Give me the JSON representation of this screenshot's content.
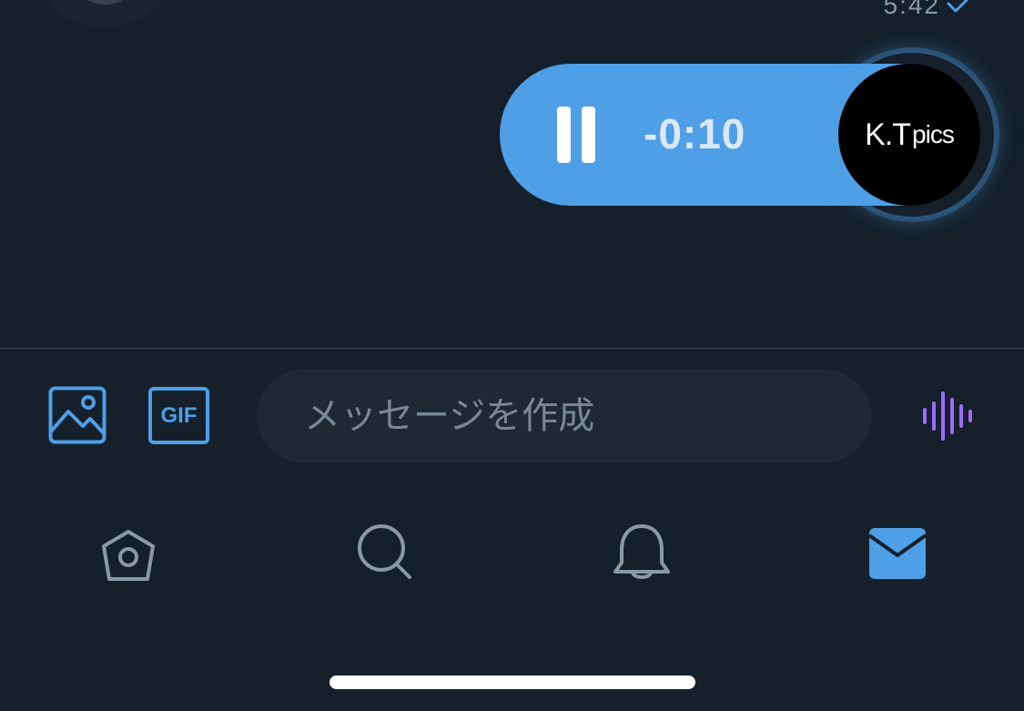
{
  "message": {
    "timestamp": "5:42",
    "voice": {
      "remaining": "-0:10",
      "state": "playing",
      "speaker_label_main": "K.T",
      "speaker_label_sub": "pics"
    }
  },
  "composer": {
    "placeholder": "メッセージを作成",
    "image_icon": "image-icon",
    "gif_label": "GIF",
    "voice_icon": "waveform-icon"
  },
  "tabbar": {
    "items": [
      {
        "name": "home",
        "icon": "home-icon",
        "active": false
      },
      {
        "name": "search",
        "icon": "search-icon",
        "active": false
      },
      {
        "name": "notifications",
        "icon": "bell-icon",
        "active": false
      },
      {
        "name": "messages",
        "icon": "mail-icon",
        "active": true
      }
    ]
  },
  "colors": {
    "background": "#15202b",
    "accent": "#4e9fe6",
    "voice_icon": "#9b6bff",
    "inactive_icon": "#8b98a5"
  }
}
